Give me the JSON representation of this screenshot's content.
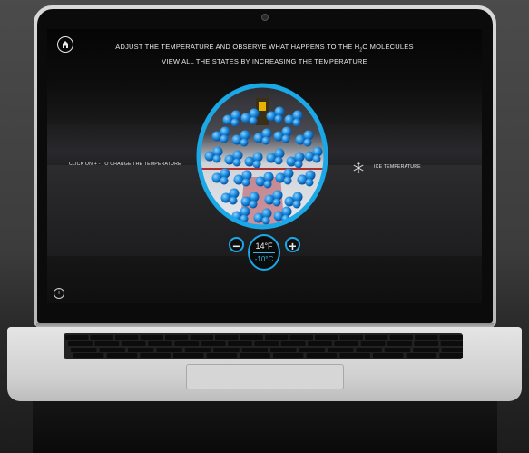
{
  "app": {
    "headline_line1": "ADJUST THE TEMPERATURE AND OBSERVE WHAT HAPPENS TO THE H",
    "headline_sub": "2",
    "headline_line1_end": "O MOLECULES",
    "headline_line2": "VIEW ALL THE STATES BY INCREASING THE TEMPERATURE",
    "left_instruction": "CLICK ON + - TO CHANGE THE TEMPERATURE",
    "state_label": "ICE TEMPERATURE",
    "temperature_f": "14°F",
    "temperature_c": "-10°C",
    "minus_label": "−",
    "plus_label": "+",
    "info_label": "i"
  },
  "colors": {
    "accent": "#1aa8e6",
    "molecule": "#1f8fe0",
    "text": "#e6e6e6"
  },
  "icons": {
    "home": "home-icon",
    "info": "info-icon",
    "snowflake": "snowflake-icon"
  }
}
